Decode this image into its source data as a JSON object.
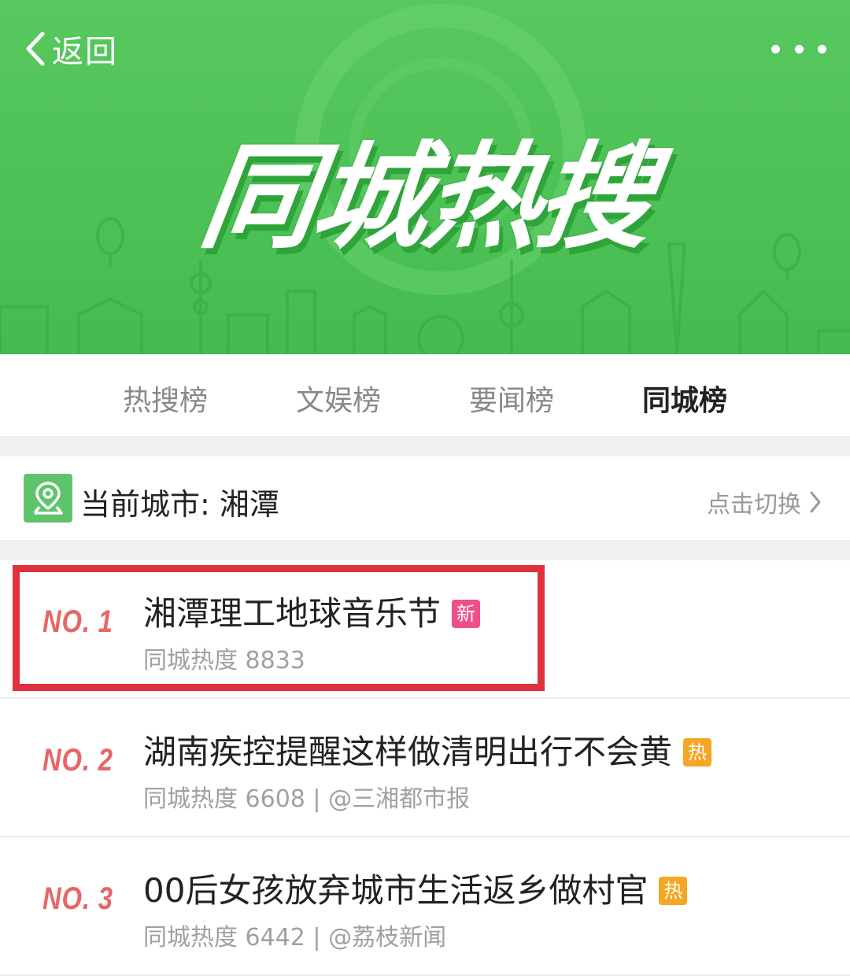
{
  "header": {
    "back_label": "返回",
    "title": "同城热搜"
  },
  "tabs": [
    {
      "label": "热搜榜",
      "active": false
    },
    {
      "label": "文娱榜",
      "active": false
    },
    {
      "label": "要闻榜",
      "active": false
    },
    {
      "label": "同城榜",
      "active": true
    }
  ],
  "city": {
    "label": "当前城市: 湘潭",
    "switch_label": "点击切换"
  },
  "items": [
    {
      "rank": "NO. 1",
      "title": "湘潭理工地球音乐节",
      "badge": "新",
      "badge_color": "#ee4f8a",
      "meta": "同城热度 8833",
      "highlighted": true
    },
    {
      "rank": "NO. 2",
      "title": "湖南疾控提醒这样做清明出行不会黄",
      "badge": "热",
      "badge_color": "#f5a623",
      "meta": "同城热度 6608 | @三湘都市报",
      "highlighted": false
    },
    {
      "rank": "NO. 3",
      "title": "00后女孩放弃城市生活返乡做村官",
      "badge": "热",
      "badge_color": "#f5a623",
      "meta": "同城热度 6442 | @荔枝新闻",
      "highlighted": false
    }
  ],
  "colors": {
    "banner_green": "#4cc155",
    "tab_indicator": "#ea5b1f",
    "rank_red": "#e86666",
    "highlight_red": "#e0303c"
  },
  "icons": [
    "chevron-left-icon",
    "more-dots-icon",
    "location-pin-icon",
    "chevron-right-icon"
  ]
}
